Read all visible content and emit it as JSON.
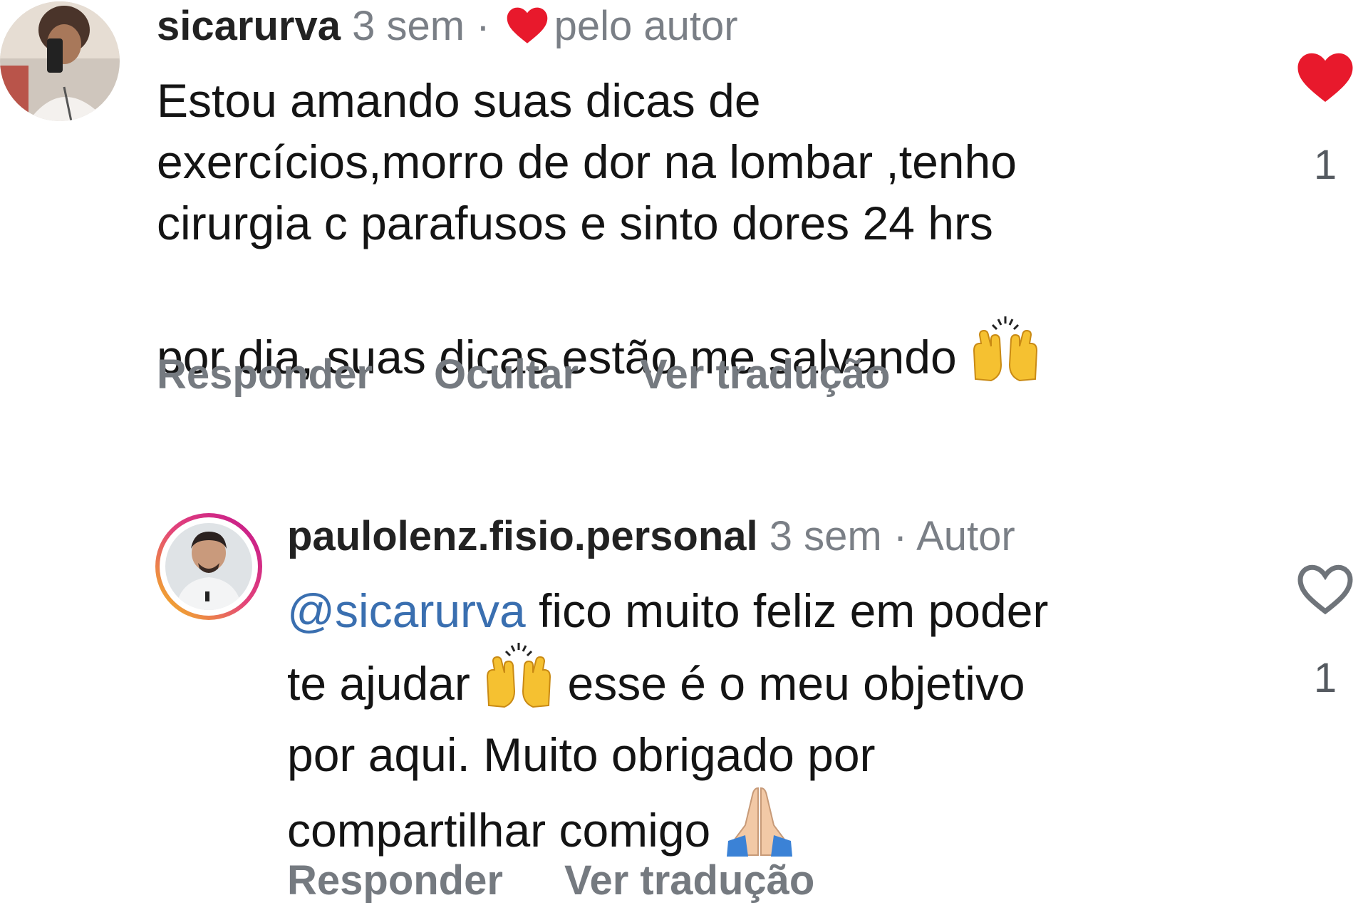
{
  "comments": [
    {
      "username": "sicarurva",
      "time": "3 sem",
      "separator": "·",
      "liked_by_author_label": "pelo autor",
      "text_lines": [
        "Estou amando suas dicas de",
        "exercícios,morro de dor na lombar ,tenho",
        "cirurgia c parafusos e sinto dores 24 hrs",
        "por dia, suas dicas estão me salvando"
      ],
      "emoji": "raising-hands",
      "actions": [
        "Responder",
        "Ocultar",
        "Ver tradução"
      ],
      "like_count": "1",
      "liked": true
    },
    {
      "username": "paulolenz.fisio.personal",
      "time": "3 sem",
      "separator": "·",
      "role_label": "Autor",
      "mention": "@sicarurva",
      "text_line1_rest": " fico muito feliz em poder",
      "text_line2_start": "te ajudar",
      "text_line2_end": "esse é o meu objetivo",
      "text_line3": "por aqui. Muito obrigado por",
      "text_line4": "compartilhar comigo",
      "emojis": [
        "raising-hands",
        "folded-hands"
      ],
      "actions": [
        "Responder",
        "Ver tradução"
      ],
      "like_count": "1",
      "liked": false
    }
  ],
  "colors": {
    "heart_red": "#e8192c",
    "meta_gray": "#7a7f86",
    "mention_blue": "#3a6fb0",
    "story_ring_start": "#f5c518",
    "story_ring_end": "#c2148e"
  }
}
